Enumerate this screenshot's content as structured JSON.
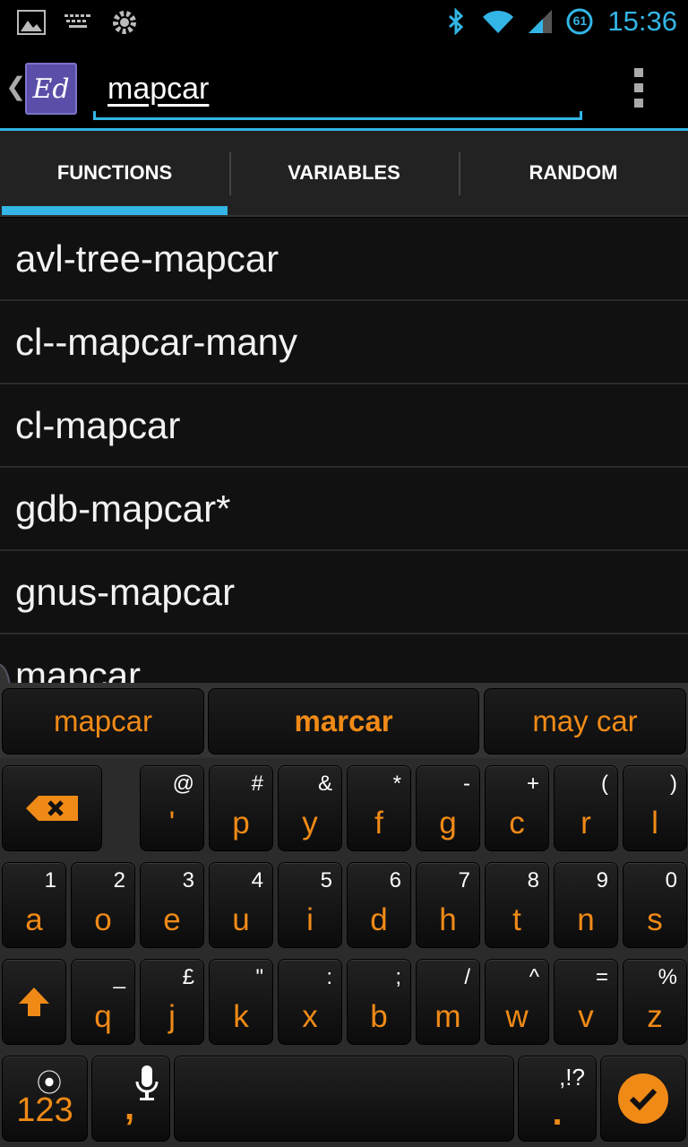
{
  "status_bar": {
    "time": "15:36",
    "battery_level": "61",
    "icons": [
      "image-icon",
      "keyboard-icon",
      "settings-icon",
      "bluetooth-icon",
      "wifi-icon",
      "signal-icon",
      "battery-icon"
    ]
  },
  "action_bar": {
    "app_icon_text": "Ed",
    "search_value": "mapcar",
    "accent_color": "#33b5e5"
  },
  "tabs": [
    {
      "label": "FUNCTIONS",
      "active": true
    },
    {
      "label": "VARIABLES",
      "active": false
    },
    {
      "label": "RANDOM",
      "active": false
    }
  ],
  "results": [
    "avl-tree-mapcar",
    "cl--mapcar-many",
    "cl-mapcar",
    "gdb-mapcar*",
    "gnus-mapcar",
    "mapcar"
  ],
  "keyboard": {
    "accent_color": "#f08a17",
    "suggestions": [
      "mapcar",
      "marcar",
      "may car"
    ],
    "row1": [
      {
        "main": "'",
        "sub": "@"
      },
      {
        "main": "p",
        "sub": "#"
      },
      {
        "main": "y",
        "sub": "&"
      },
      {
        "main": "f",
        "sub": "*"
      },
      {
        "main": "g",
        "sub": "-"
      },
      {
        "main": "c",
        "sub": "+"
      },
      {
        "main": "r",
        "sub": "("
      },
      {
        "main": "l",
        "sub": ")"
      }
    ],
    "row2": [
      {
        "main": "a",
        "sub": "1"
      },
      {
        "main": "o",
        "sub": "2"
      },
      {
        "main": "e",
        "sub": "3"
      },
      {
        "main": "u",
        "sub": "4"
      },
      {
        "main": "i",
        "sub": "5"
      },
      {
        "main": "d",
        "sub": "6"
      },
      {
        "main": "h",
        "sub": "7"
      },
      {
        "main": "t",
        "sub": "8"
      },
      {
        "main": "n",
        "sub": "9"
      },
      {
        "main": "s",
        "sub": "0"
      }
    ],
    "row3": [
      {
        "main": "q",
        "sub": "_"
      },
      {
        "main": "j",
        "sub": "£"
      },
      {
        "main": "k",
        "sub": "\""
      },
      {
        "main": "x",
        "sub": ":"
      },
      {
        "main": "b",
        "sub": ";"
      },
      {
        "main": "m",
        "sub": "/"
      },
      {
        "main": "w",
        "sub": "^"
      },
      {
        "main": "v",
        "sub": "="
      },
      {
        "main": "z",
        "sub": "%"
      }
    ],
    "numbers_label": "123",
    "comma_label": ",",
    "punct_main": ".",
    "punct_sub": ",!?"
  }
}
